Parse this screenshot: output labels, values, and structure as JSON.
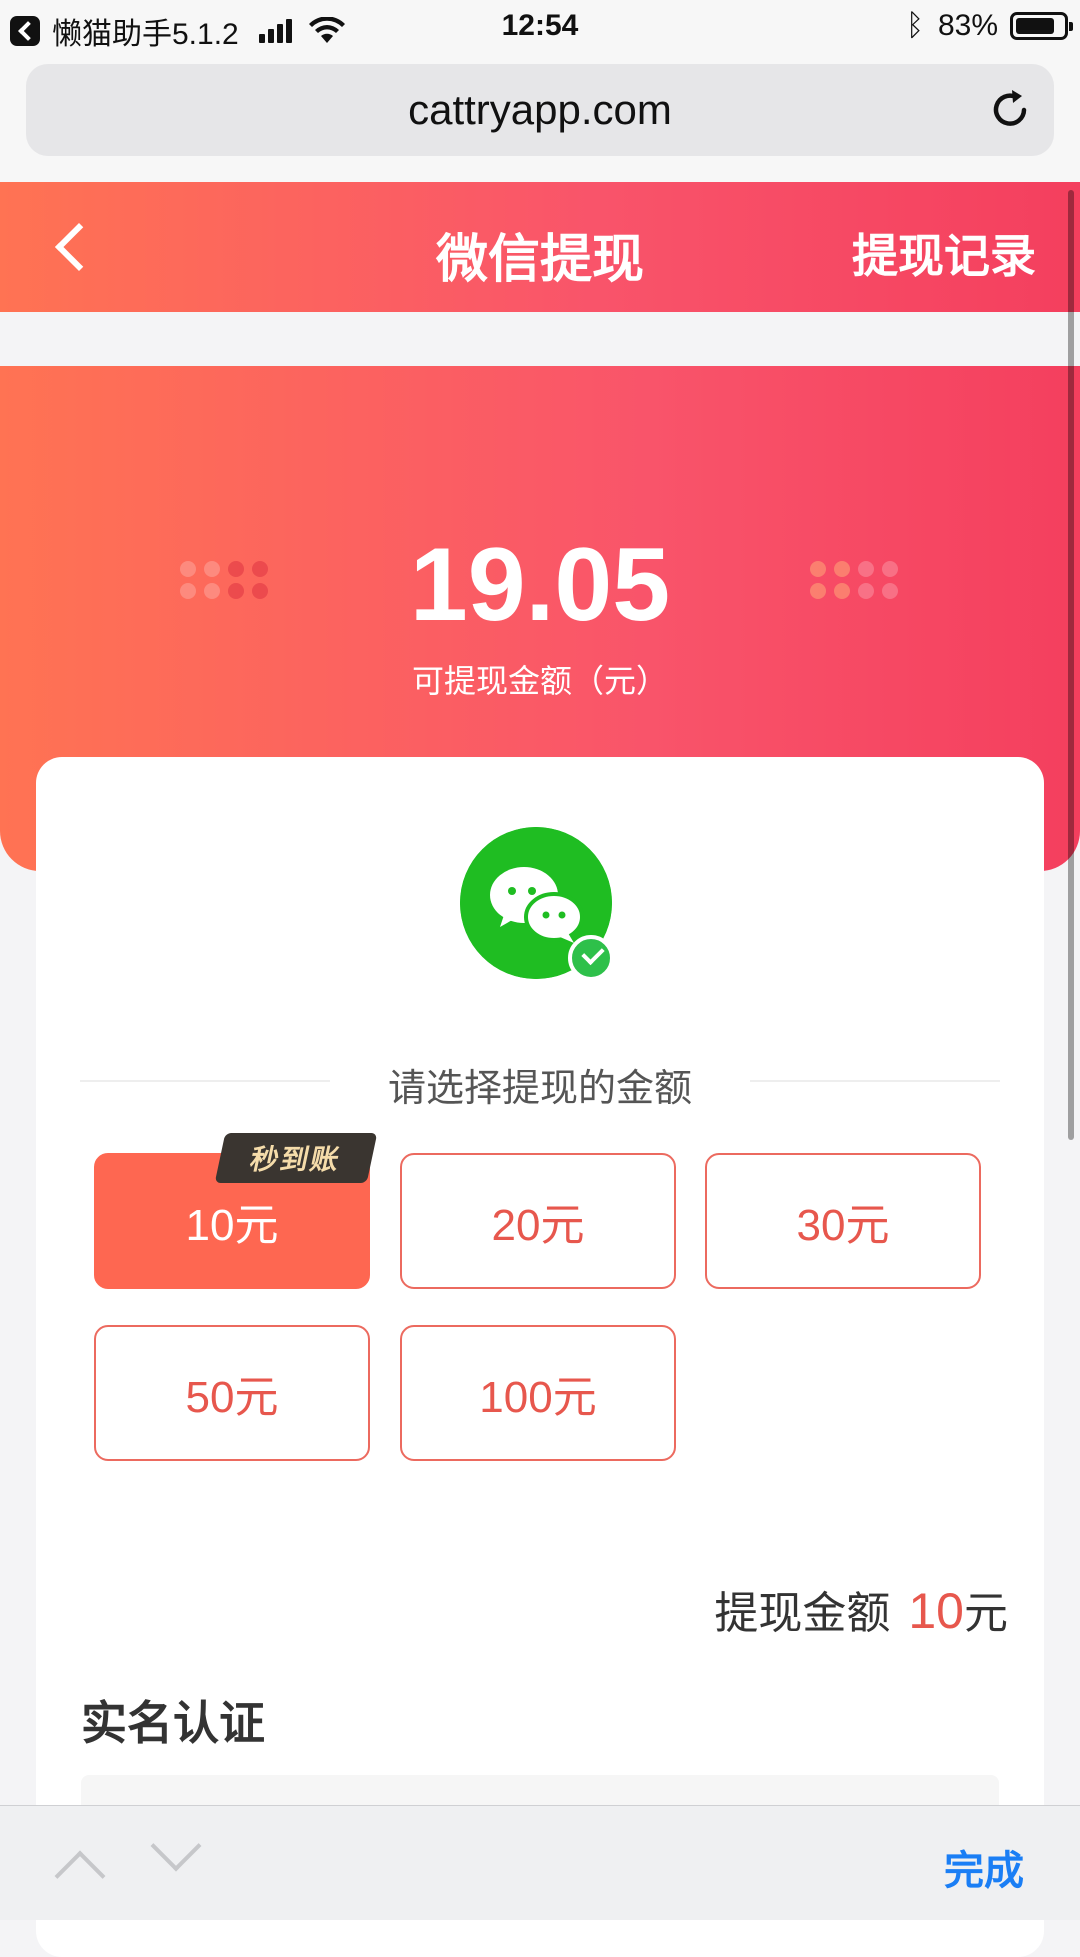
{
  "status_bar": {
    "app_name": "懒猫助手5.1.2",
    "time": "12:54",
    "battery": "83%",
    "battery_level": 0.83
  },
  "browser": {
    "url": "cattryapp.com"
  },
  "header": {
    "title": "微信提现",
    "right_action": "提现记录"
  },
  "balance": {
    "amount": "19.05",
    "label": "可提现金额（元）"
  },
  "payment_method": "wechat",
  "section_title": "请选择提现的金额",
  "amount_options": [
    {
      "label": "10元",
      "selected": true
    },
    {
      "label": "20元",
      "selected": false
    },
    {
      "label": "30元",
      "selected": false
    },
    {
      "label": "50元",
      "selected": false
    },
    {
      "label": "100元",
      "selected": false
    }
  ],
  "instant_badge": "秒到账",
  "summary": {
    "label": "提现金额",
    "value": "10",
    "unit": "元"
  },
  "realname": {
    "title": "实名认证"
  },
  "keyboard_bar": {
    "done_label": "完成"
  },
  "colors": {
    "accent": "#fe6751",
    "gradient_start": "#ff7353",
    "gradient_end": "#f43f5e",
    "wechat_green": "#1fbd22",
    "done_blue": "#1a7ef5"
  }
}
